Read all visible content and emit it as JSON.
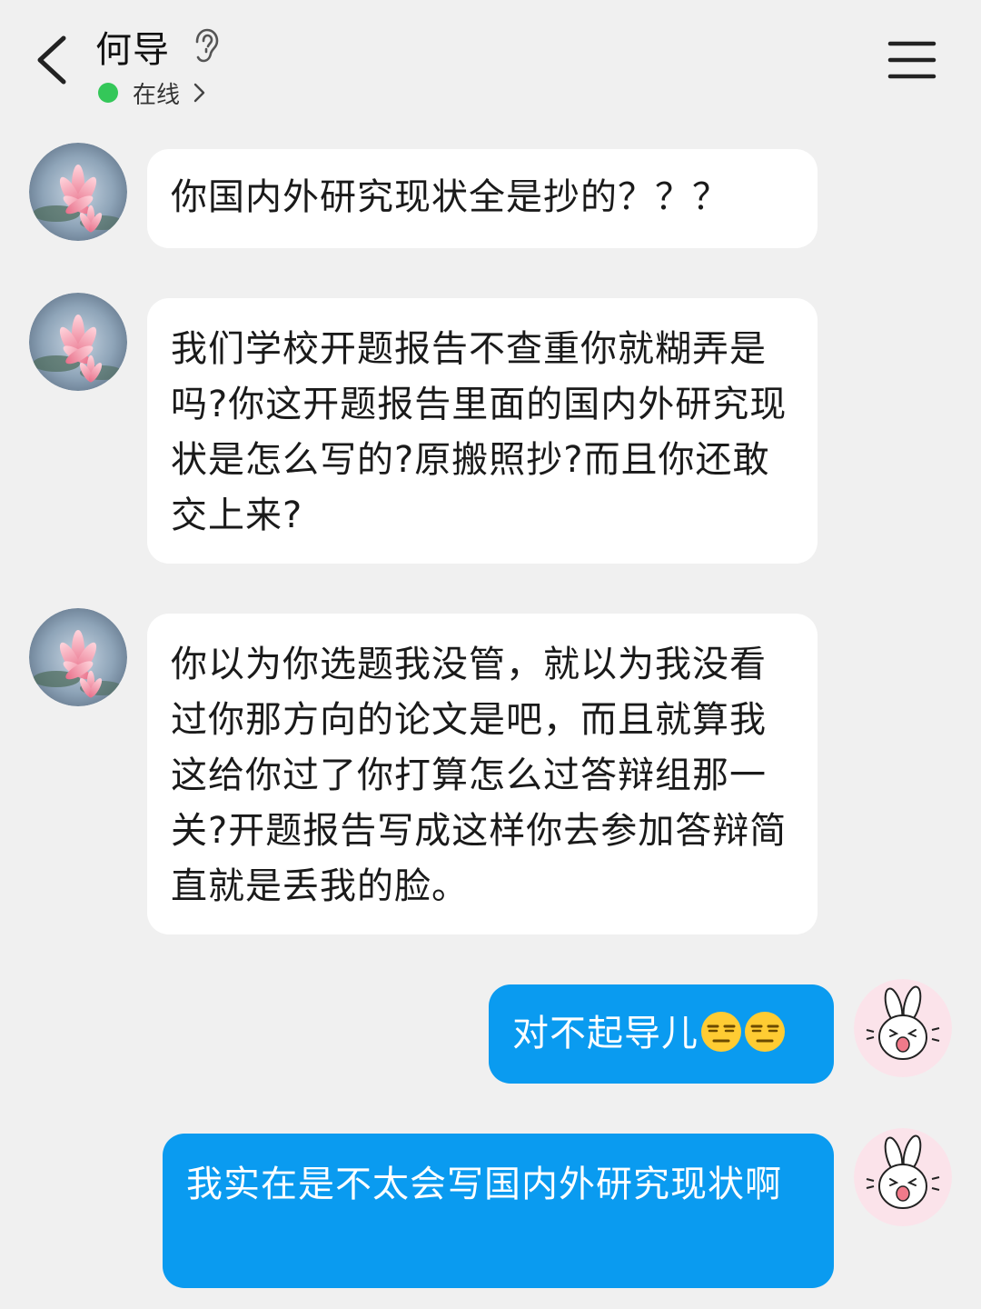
{
  "header": {
    "contact_name": "何导",
    "status": "在线"
  },
  "messages": [
    {
      "side": "in",
      "text": "你国内外研究现状全是抄的？？？"
    },
    {
      "side": "in",
      "text": "我们学校开题报告不查重你就糊弄是吗?你这开题报告里面的国内外研究现状是怎么写的?原搬照抄?而且你还敢交上来?"
    },
    {
      "side": "in",
      "text": "你以为你选题我没管，就以为我没看过你那方向的论文是吧，而且就算我这给你过了你打算怎么过答辩组那一关?开题报告写成这样你去参加答辩简直就是丢我的脸。"
    },
    {
      "side": "out",
      "text": "对不起导儿",
      "emojis": [
        "unamused-face",
        "unamused-face"
      ]
    },
    {
      "side": "out",
      "text": "我实在是不太会写国内外研究现状啊"
    }
  ],
  "colors": {
    "background": "#f0f0f0",
    "incoming_bubble": "#ffffff",
    "outgoing_bubble": "#0a9bf0",
    "online": "#34c759"
  },
  "icons": {
    "back": "chevron-left-icon",
    "ear": "ear-icon",
    "menu": "hamburger-menu-icon",
    "status_chevron": "chevron-right-icon"
  }
}
